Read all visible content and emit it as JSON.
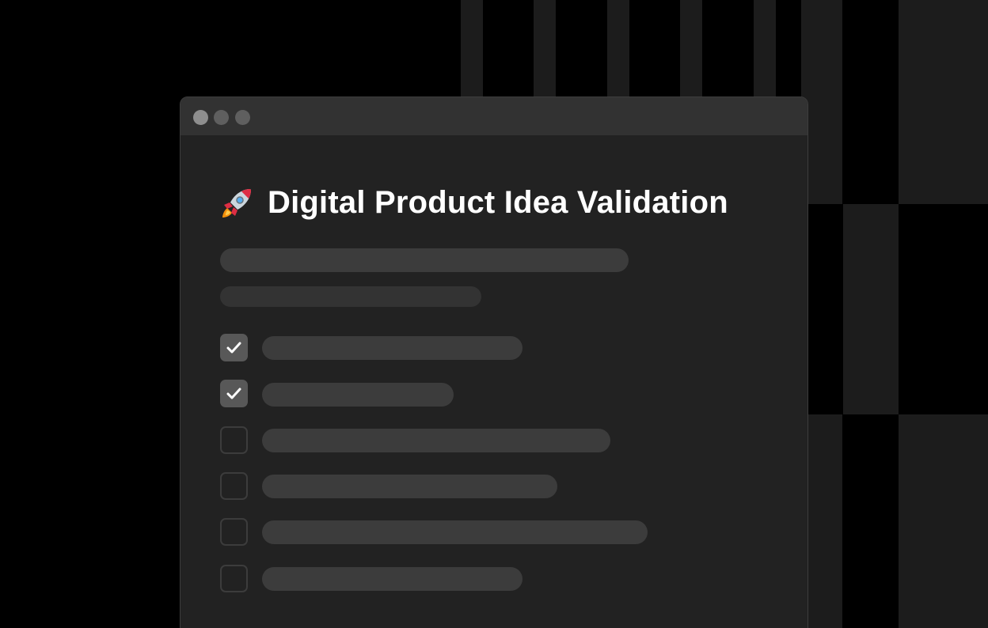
{
  "window": {
    "title": "Digital Product Idea Validation",
    "title_icon": "rocket-icon",
    "controls": [
      "close",
      "minimize",
      "maximize"
    ]
  },
  "placeholder_lines": 2,
  "checklist": [
    {
      "checked": true
    },
    {
      "checked": true
    },
    {
      "checked": false
    },
    {
      "checked": false
    },
    {
      "checked": false
    },
    {
      "checked": false
    }
  ],
  "colors": {
    "background": "#000000",
    "window": "#222222",
    "titlebar": "#323232",
    "skeleton": "#3c3c3c",
    "checkbox_checked": "#585858",
    "text": "#ffffff"
  }
}
